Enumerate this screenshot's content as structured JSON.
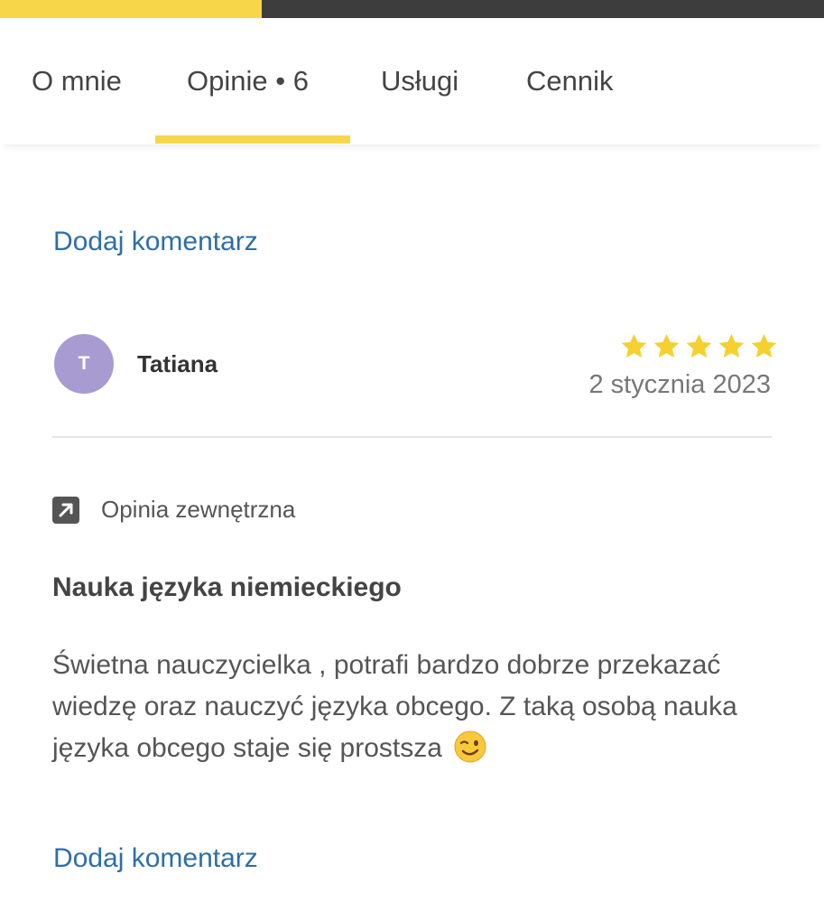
{
  "progress": {
    "fraction": 0.318,
    "fill_color": "#f7d64a",
    "track_color": "#3d3d3d"
  },
  "tabs": [
    {
      "label": "O mnie"
    },
    {
      "label": "Opinie • 6",
      "active": true
    },
    {
      "label": "Usługi"
    },
    {
      "label": "Cennik"
    }
  ],
  "actions": {
    "add_comment_top": "Dodaj komentarz",
    "add_comment_bottom": "Dodaj komentarz"
  },
  "review": {
    "avatar_initial": "T",
    "avatar_color": "#a89bd1",
    "author": "Tatiana",
    "rating": 5,
    "rating_max": 5,
    "star_color": "#f5d02f",
    "date": "2 stycznia 2023",
    "source_icon": "external-link-icon",
    "source_label": "Opinia zewnętrzna",
    "title": "Nauka języka niemieckiego",
    "body": "Świetna nauczycielka , potrafi bardzo dobrze przekazać wiedzę oraz nauczyć języka obcego. Z taką osobą nauka języka obcego staje się prostsza",
    "body_emoji": "winking-face-icon"
  },
  "colors": {
    "link": "#2e6ea8",
    "accent": "#f7d64a"
  }
}
